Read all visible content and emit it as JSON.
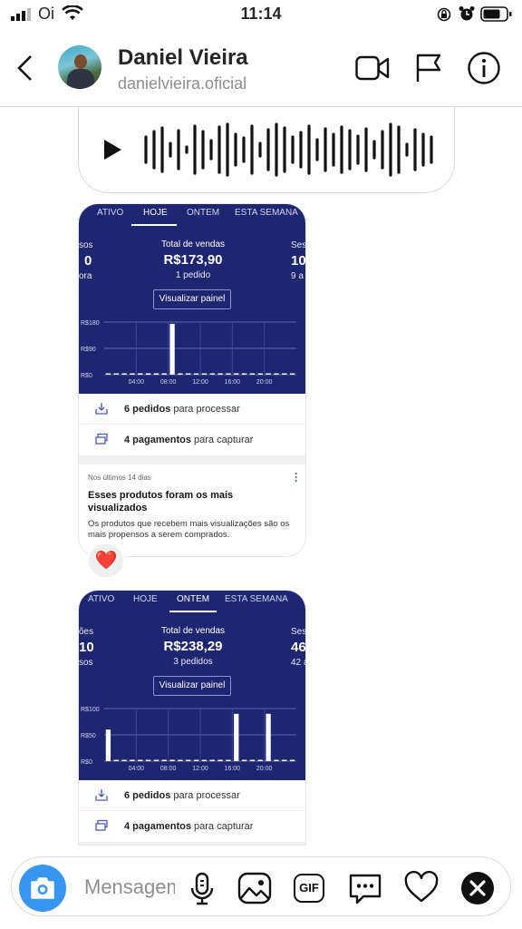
{
  "status_bar": {
    "carrier": "Oi",
    "time": "11:14"
  },
  "header": {
    "back_icon": "chevron-left-icon",
    "name": "Daniel Vieira",
    "handle": "danielvieira.oficial",
    "video_icon": "video-camera-icon",
    "report_icon": "flag-icon",
    "info_icon": "info-icon"
  },
  "voice_message": {
    "play_icon": "play-icon"
  },
  "card1": {
    "tabs": [
      "ATIVO",
      "HOJE",
      "ONTEM",
      "ESTA SEMANA"
    ],
    "active_tab": "HOJE",
    "left_partial": {
      "label": "sos",
      "value": "0",
      "sub": "ora"
    },
    "center": {
      "label": "Total de vendas",
      "value": "R$173,90",
      "sub": "1 pedido"
    },
    "right_partial": {
      "label": "Ses",
      "value": "10",
      "sub": "9 a"
    },
    "panel_button": "Visualizar painel",
    "chart_data": {
      "type": "bar",
      "ylabels": [
        "R$180",
        "R$90",
        "R$0"
      ],
      "xlabels": [
        "04:00",
        "08:00",
        "12:00",
        "16:00",
        "20:00"
      ],
      "ylim": [
        0,
        180
      ],
      "hours": [
        0,
        1,
        2,
        3,
        4,
        5,
        6,
        7,
        8,
        9,
        10,
        11,
        12,
        13,
        14,
        15,
        16,
        15,
        18,
        19,
        20,
        21,
        22,
        23
      ],
      "values": [
        0,
        0,
        0,
        0,
        0,
        0,
        0,
        0,
        173.9,
        0,
        0,
        0,
        0,
        0,
        0,
        0,
        0,
        0,
        0,
        0,
        0,
        0,
        0,
        0
      ]
    },
    "rows": [
      {
        "bold": "6 pedidos",
        "rest": " para processar",
        "icon": "inbox-download-icon"
      },
      {
        "bold": "4 pagamentos",
        "rest": " para capturar",
        "icon": "cards-icon"
      }
    ],
    "insight": {
      "meta": "Nos últimos 14 dias",
      "title": "Esses produtos foram os mais visualizados",
      "desc": "Os produtos que recebem mais visualizações são os mais propensos a serem comprados."
    }
  },
  "reaction": "❤️",
  "card2": {
    "tabs": [
      "ATIVO",
      "HOJE",
      "ONTEM",
      "ESTA SEMANA"
    ],
    "active_tab": "ONTEM",
    "left_partial": {
      "label": "ões",
      "value": "10",
      "sub": "sos"
    },
    "center": {
      "label": "Total de vendas",
      "value": "R$238,29",
      "sub": "3 pedidos"
    },
    "right_partial": {
      "label": "Ses",
      "value": "46",
      "sub": "42 a"
    },
    "panel_button": "Visualizar painel",
    "chart_data": {
      "type": "bar",
      "ylabels": [
        "R$100",
        "R$50",
        "R$0"
      ],
      "xlabels": [
        "04:00",
        "08:00",
        "12:00",
        "16:00",
        "20:00"
      ],
      "ylim": [
        0,
        100
      ],
      "values": [
        60,
        0,
        0,
        0,
        0,
        0,
        0,
        0,
        0,
        0,
        0,
        0,
        0,
        0,
        0,
        0,
        90,
        0,
        0,
        0,
        90,
        0,
        0,
        0
      ]
    },
    "rows": [
      {
        "bold": "6 pedidos",
        "rest": " para processar",
        "icon": "inbox-download-icon"
      },
      {
        "bold": "4 pagamentos",
        "rest": " para capturar",
        "icon": "cards-icon"
      }
    ]
  },
  "composer": {
    "placeholder": "Mensagem...",
    "camera_icon": "camera-icon",
    "mic_icon": "microphone-icon",
    "gallery_icon": "image-icon",
    "gif_label": "GIF",
    "more_icon": "chat-more-icon",
    "like_icon": "heart-icon",
    "close_icon": "close-icon"
  },
  "colors": {
    "card_navy": "#1d2671",
    "accent_blue": "#3797f0",
    "reaction_red": "#ed4956"
  }
}
